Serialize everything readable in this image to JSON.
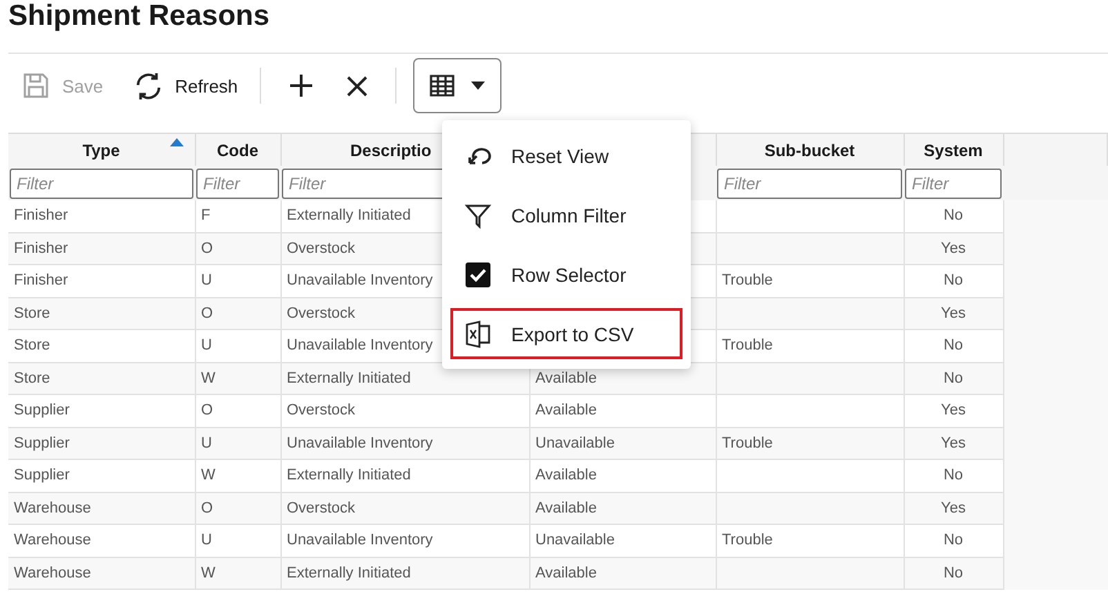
{
  "page": {
    "title": "Shipment Reasons"
  },
  "toolbar": {
    "save": {
      "label": "Save",
      "disabled": true
    },
    "refresh": {
      "label": "Refresh"
    }
  },
  "table": {
    "columns": [
      {
        "label": "Type",
        "sorted": true,
        "filter_placeholder": "Filter"
      },
      {
        "label": "Code",
        "sorted": false,
        "filter_placeholder": "Filter"
      },
      {
        "label": "Descriptio",
        "sorted": false,
        "filter_placeholder": "Filter"
      },
      {
        "sorted": false
      },
      {
        "label": "Sub-bucket",
        "sorted": false,
        "filter_placeholder": "Filter"
      },
      {
        "label": "System",
        "sorted": false,
        "filter_placeholder": "Filter"
      }
    ],
    "rows": [
      [
        "Finisher",
        "F",
        "Externally Initiated",
        "",
        "",
        "No"
      ],
      [
        "Finisher",
        "O",
        "Overstock",
        "",
        "",
        "Yes"
      ],
      [
        "Finisher",
        "U",
        "Unavailable Inventory",
        "",
        "Trouble",
        "No"
      ],
      [
        "Store",
        "O",
        "Overstock",
        "",
        "",
        "Yes"
      ],
      [
        "Store",
        "U",
        "Unavailable Inventory",
        "",
        "Trouble",
        "No"
      ],
      [
        "Store",
        "W",
        "Externally Initiated",
        "Available",
        "",
        "No"
      ],
      [
        "Supplier",
        "O",
        "Overstock",
        "Available",
        "",
        "Yes"
      ],
      [
        "Supplier",
        "U",
        "Unavailable Inventory",
        "Unavailable",
        "Trouble",
        "Yes"
      ],
      [
        "Supplier",
        "W",
        "Externally Initiated",
        "Available",
        "",
        "No"
      ],
      [
        "Warehouse",
        "O",
        "Overstock",
        "Available",
        "",
        "Yes"
      ],
      [
        "Warehouse",
        "U",
        "Unavailable Inventory",
        "Unavailable",
        "Trouble",
        "No"
      ],
      [
        "Warehouse",
        "W",
        "Externally Initiated",
        "Available",
        "",
        "No"
      ]
    ]
  },
  "view_menu": {
    "items": [
      {
        "kind": "reset",
        "label": "Reset View",
        "focused": false
      },
      {
        "kind": "filter",
        "label": "Column Filter",
        "focused": false
      },
      {
        "kind": "checkbox",
        "label": "Row Selector",
        "checked": true,
        "focused": false
      },
      {
        "kind": "export",
        "label": "Export to CSV",
        "focused": true
      }
    ]
  }
}
